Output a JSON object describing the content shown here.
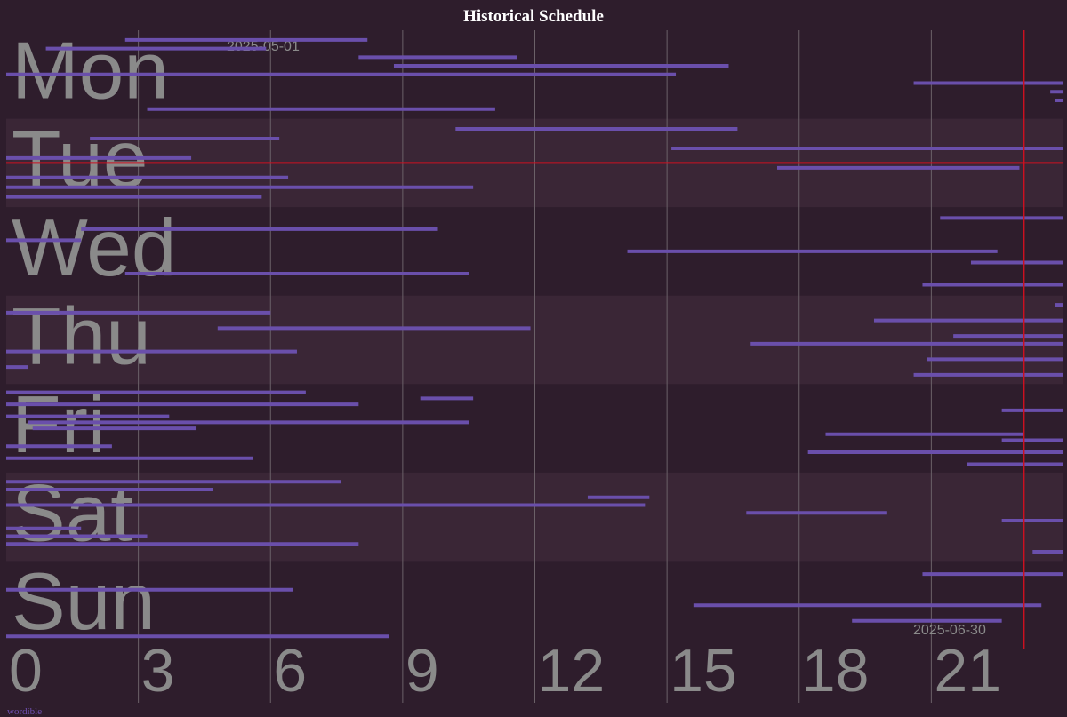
{
  "title": "Historical Schedule",
  "footer": "wordible",
  "colors": {
    "background": "#2e1d2c",
    "band_alt": "#3a2636",
    "grid": "#6b6168",
    "bar": "#6a4fab",
    "now_line": "#cc1020",
    "label": "#8a8a8a"
  },
  "chart_data": {
    "type": "gantt",
    "title": "Historical Schedule",
    "days": [
      "Mon",
      "Tue",
      "Wed",
      "Thu",
      "Fri",
      "Sat",
      "Sun"
    ],
    "x_ticks": [
      0,
      3,
      6,
      9,
      12,
      15,
      18,
      21
    ],
    "xlim": [
      0,
      24
    ],
    "grid": true,
    "date_start": "2025-05-01",
    "date_end": "2025-06-30",
    "now": {
      "day": "Tue",
      "hour": 23.1
    },
    "bars": [
      {
        "day": "Mon",
        "start": 2.7,
        "end": 8.2
      },
      {
        "day": "Mon",
        "start": 0.9,
        "end": 5.9
      },
      {
        "day": "Mon",
        "start": 8.0,
        "end": 11.6
      },
      {
        "day": "Mon",
        "start": 8.8,
        "end": 16.4
      },
      {
        "day": "Mon",
        "start": 0.0,
        "end": 15.2
      },
      {
        "day": "Mon",
        "start": 20.6,
        "end": 24.0
      },
      {
        "day": "Mon",
        "start": 23.7,
        "end": 24.0
      },
      {
        "day": "Mon",
        "start": 23.8,
        "end": 24.0
      },
      {
        "day": "Mon",
        "start": 3.2,
        "end": 11.1
      },
      {
        "day": "Tue",
        "start": 10.2,
        "end": 16.6
      },
      {
        "day": "Tue",
        "start": 1.9,
        "end": 6.2
      },
      {
        "day": "Tue",
        "start": 15.1,
        "end": 24.0
      },
      {
        "day": "Tue",
        "start": 0.0,
        "end": 4.2
      },
      {
        "day": "Tue",
        "start": 17.5,
        "end": 23.0
      },
      {
        "day": "Tue",
        "start": 0.0,
        "end": 6.4
      },
      {
        "day": "Tue",
        "start": 0.0,
        "end": 10.6
      },
      {
        "day": "Tue",
        "start": 0.0,
        "end": 5.8
      },
      {
        "day": "Wed",
        "start": 21.2,
        "end": 24.0
      },
      {
        "day": "Wed",
        "start": 1.7,
        "end": 9.8
      },
      {
        "day": "Wed",
        "start": 0.0,
        "end": 1.7
      },
      {
        "day": "Wed",
        "start": 14.1,
        "end": 22.5
      },
      {
        "day": "Wed",
        "start": 21.9,
        "end": 24.0
      },
      {
        "day": "Wed",
        "start": 2.7,
        "end": 10.5
      },
      {
        "day": "Wed",
        "start": 20.8,
        "end": 24.0
      },
      {
        "day": "Thu",
        "start": 23.8,
        "end": 24.0
      },
      {
        "day": "Thu",
        "start": 0.0,
        "end": 6.0
      },
      {
        "day": "Thu",
        "start": 19.7,
        "end": 24.0
      },
      {
        "day": "Thu",
        "start": 4.8,
        "end": 11.9
      },
      {
        "day": "Thu",
        "start": 21.5,
        "end": 24.0
      },
      {
        "day": "Thu",
        "start": 16.9,
        "end": 24.0
      },
      {
        "day": "Thu",
        "start": 0.0,
        "end": 6.6
      },
      {
        "day": "Thu",
        "start": 20.9,
        "end": 24.0
      },
      {
        "day": "Thu",
        "start": 0.0,
        "end": 0.5
      },
      {
        "day": "Thu",
        "start": 20.6,
        "end": 24.0
      },
      {
        "day": "Fri",
        "start": 0.0,
        "end": 6.8
      },
      {
        "day": "Fri",
        "start": 9.4,
        "end": 10.6
      },
      {
        "day": "Fri",
        "start": 0.0,
        "end": 8.0
      },
      {
        "day": "Fri",
        "start": 22.6,
        "end": 24.0
      },
      {
        "day": "Fri",
        "start": 0.0,
        "end": 3.7
      },
      {
        "day": "Fri",
        "start": 0.5,
        "end": 10.5
      },
      {
        "day": "Fri",
        "start": 0.6,
        "end": 4.3
      },
      {
        "day": "Fri",
        "start": 18.6,
        "end": 23.1
      },
      {
        "day": "Fri",
        "start": 22.6,
        "end": 24.0
      },
      {
        "day": "Fri",
        "start": 0.0,
        "end": 2.4
      },
      {
        "day": "Fri",
        "start": 18.2,
        "end": 24.0
      },
      {
        "day": "Fri",
        "start": 0.0,
        "end": 5.6
      },
      {
        "day": "Fri",
        "start": 21.8,
        "end": 24.0
      },
      {
        "day": "Sat",
        "start": 0.0,
        "end": 7.6
      },
      {
        "day": "Sat",
        "start": 0.0,
        "end": 4.7
      },
      {
        "day": "Sat",
        "start": 13.2,
        "end": 14.6
      },
      {
        "day": "Sat",
        "start": 0.0,
        "end": 14.5
      },
      {
        "day": "Sat",
        "start": 16.8,
        "end": 20.0
      },
      {
        "day": "Sat",
        "start": 22.6,
        "end": 24.0
      },
      {
        "day": "Sat",
        "start": 0.0,
        "end": 1.7
      },
      {
        "day": "Sat",
        "start": 0.0,
        "end": 3.2
      },
      {
        "day": "Sat",
        "start": 0.0,
        "end": 8.0
      },
      {
        "day": "Sat",
        "start": 23.3,
        "end": 24.0
      },
      {
        "day": "Sun",
        "start": 20.8,
        "end": 24.0
      },
      {
        "day": "Sun",
        "start": 0.0,
        "end": 6.5
      },
      {
        "day": "Sun",
        "start": 15.6,
        "end": 23.5
      },
      {
        "day": "Sun",
        "start": 19.2,
        "end": 22.6
      },
      {
        "day": "Sun",
        "start": 0.0,
        "end": 8.7
      }
    ]
  }
}
